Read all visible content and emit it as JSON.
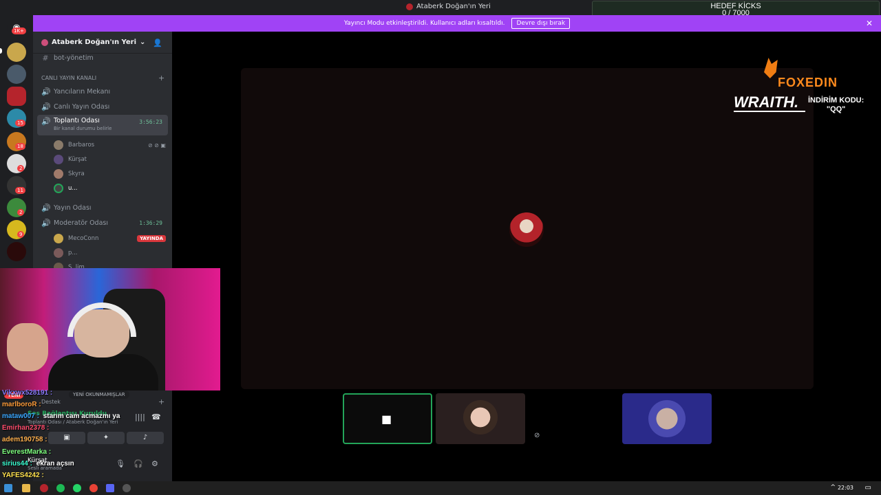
{
  "window": {
    "title": "Ataberk Doğan'ın Yeri"
  },
  "banner": {
    "text": "Yayıncı Modu etkinleştirildi. Kullanıcı adları kısaltıldı.",
    "button": "Devre dışı bırak",
    "close": "✕"
  },
  "goal": {
    "title": "HEDEF KİCKS",
    "value": "0 / 7000"
  },
  "rail": {
    "home_badge": "1K+",
    "badges": [
      "15",
      "18",
      "2",
      "11",
      "2",
      "9"
    ]
  },
  "server": {
    "name": "Ataberk Doğan'ın Yeri",
    "chevron": "⌄"
  },
  "channels": {
    "bot": "bot-yönetim",
    "category": "CANLI YAYIN KANALI",
    "category_add": "+",
    "ch1": "Yancıların Mekanı",
    "ch2": "Canlı Yayın Odası",
    "active": {
      "name": "Toplantı Odası",
      "status": "Bir kanal durumu belirle",
      "timer": "3:56:23"
    },
    "active_users": [
      "Barbaros",
      "Kürşat",
      "Skyra",
      "u..."
    ],
    "ch4": "Yayın Odası",
    "ch5": {
      "name": "Moderatör Odası",
      "timer": "1:36:29"
    },
    "mod_users": [
      {
        "name": "MecoConn",
        "live": "YAYINDA"
      },
      {
        "name": "p..."
      },
      {
        "name": "S..lim"
      }
    ]
  },
  "overlay": {
    "brand": "FOXEDIN",
    "sponsor": "WRAITH.",
    "promo_line1": "İNDİRİM KODU:",
    "promo_line2": "\"QQ\""
  },
  "voice": {
    "connected": "Ses Bağlantısı Kuruldu",
    "location": "Toplantı Odası / Ataberk Doğan'ın Yeri",
    "me_name": "Kürşat",
    "me_status": "Sesli aramada",
    "unread": "YENİ OKUNMAMIŞLAR",
    "new": "YENİ",
    "destek": "Destek"
  },
  "chat": [
    {
      "user": "Vikxwx528191",
      "msg": "",
      "color": "#8b7bff"
    },
    {
      "user": "marlboroR",
      "msg": "",
      "color": "#ff9c3a"
    },
    {
      "user": "mataw007",
      "msg": "starım cam acmazmı ya",
      "color": "#3aa7ff"
    },
    {
      "user": "Emirhan2378",
      "msg": "",
      "color": "#ff4d6d"
    },
    {
      "user": "adem190758",
      "msg": "",
      "color": "#ffb04d"
    },
    {
      "user": "EverestMarka",
      "msg": "",
      "color": "#7dff7d"
    },
    {
      "user": "sirius44",
      "msg": "ekran açsın",
      "color": "#3affd2"
    },
    {
      "user": "YAFES4242",
      "msg": "",
      "color": "#ffe14d"
    }
  ],
  "taskbar": {
    "time": "22:03"
  },
  "colors": {
    "accent": "#a043f5",
    "live": "#da373c",
    "speaking": "#23a559"
  }
}
